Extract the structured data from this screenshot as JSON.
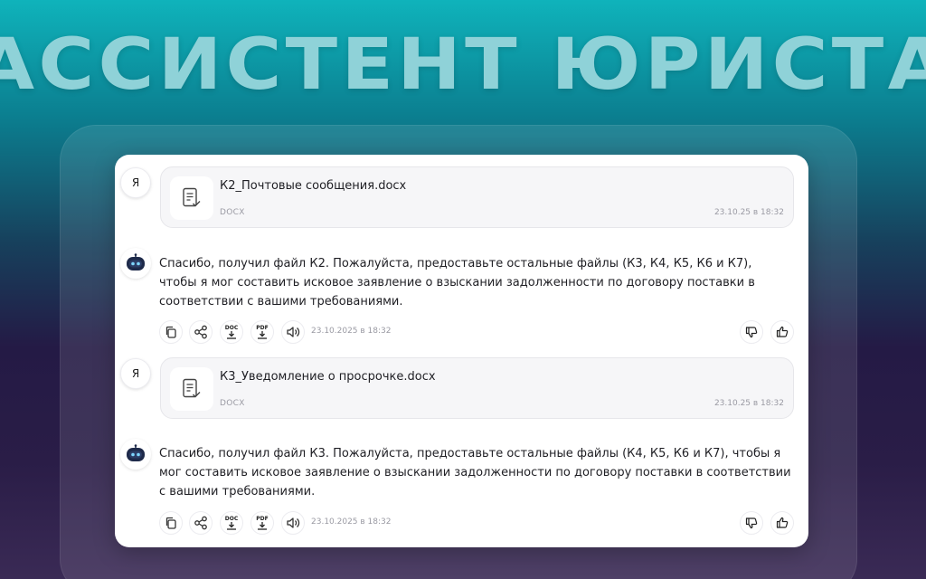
{
  "hero": {
    "title": "АССИСТЕНТ ЮРИСТА"
  },
  "messages": [
    {
      "type": "user-file",
      "avatar": "Я",
      "file_name": "К2_Почтовые сообщения.docx",
      "file_type": "DOCX",
      "time": "23.10.25 в 18:32"
    },
    {
      "type": "bot",
      "text": "Спасибо, получил файл К2. Пожалуйста, предоставьте остальные файлы (К3, К4, К5, К6 и К7), чтобы я мог составить исковое заявление о взыскании задолженности по договору поставки в соответствии с вашими требованиями.",
      "time": "23.10.2025 в 18:32"
    },
    {
      "type": "user-file",
      "avatar": "Я",
      "file_name": "К3_Уведомление о просрочке.docx",
      "file_type": "DOCX",
      "time": "23.10.25 в 18:32"
    },
    {
      "type": "bot",
      "text": "Спасибо, получил файл К3. Пожалуйста, предоставьте остальные файлы (К4, К5, К6 и К7), чтобы я мог составить исковое заявление о взыскании задолженности по договору поставки в соответствии с вашими требованиями.",
      "time": "23.10.2025 в 18:32"
    }
  ],
  "action_labels": {
    "doc": "DOC",
    "pdf": "PDF"
  },
  "icons": [
    "document-icon",
    "copy-icon",
    "share-icon",
    "download-doc-icon",
    "download-pdf-icon",
    "speaker-icon",
    "thumbs-down-icon",
    "thumbs-up-icon",
    "robot-icon"
  ],
  "colors": {
    "accent_teal": "#0fb3bb",
    "title": "#8fd2d8",
    "robot": "#1e2a4a"
  }
}
